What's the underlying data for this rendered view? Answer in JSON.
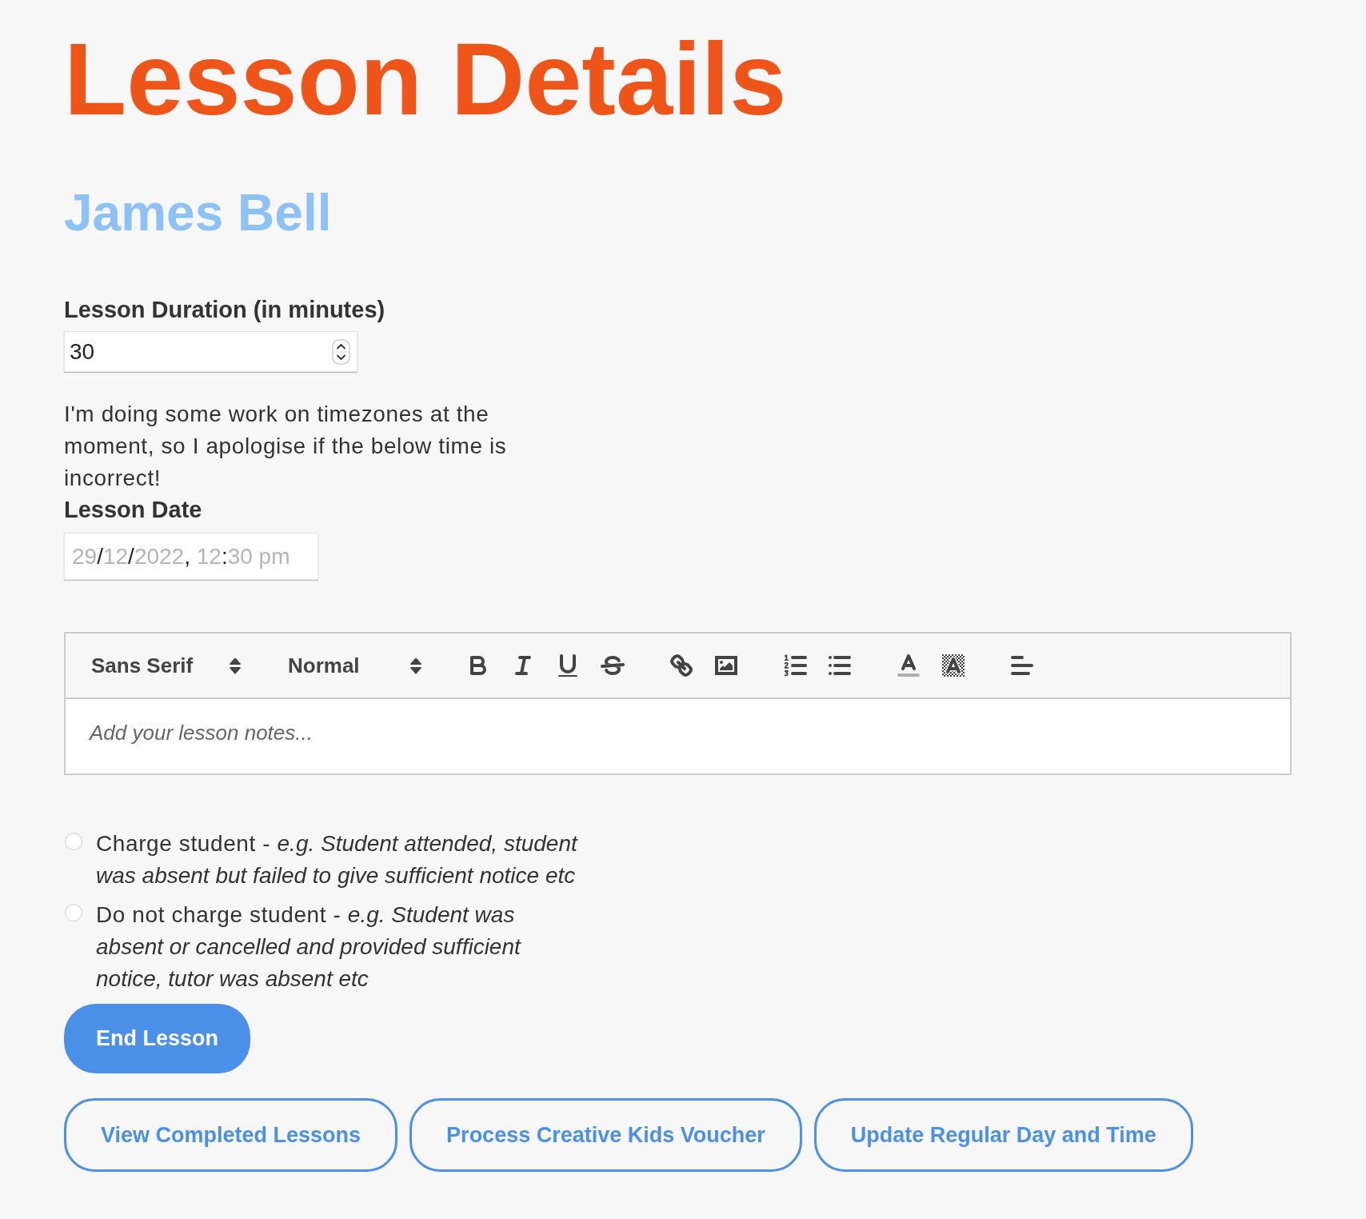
{
  "title": "Lesson Details",
  "student_name": "James Bell",
  "duration": {
    "label": "Lesson Duration (in minutes)",
    "value": "30"
  },
  "notice": "I'm doing some work on timezones at the moment, so I apologise if the below time is incorrect!",
  "lesson_date": {
    "label": "Lesson Date",
    "placeholder": "29/12/2022, 12:30 pm"
  },
  "editor": {
    "pickers": [
      {
        "kind": "font",
        "label": "Sans Serif"
      },
      {
        "kind": "heading",
        "label": "Normal"
      }
    ],
    "placeholder": "Add your lesson notes..."
  },
  "charge_options": [
    {
      "label": "Charge student - *e.g. Student attended, student was absent but failed to give sufficient notice etc*",
      "selected": false
    },
    {
      "label": "Do not charge student - *e.g. Student was absent or cancelled and provided sufficient notice, tutor was absent etc*",
      "selected": false
    }
  ],
  "end_button": "End Lesson",
  "action_buttons": [
    "View Completed Lessons",
    "Process Creative Kids Voucher",
    "Update Regular Day and Time"
  ]
}
